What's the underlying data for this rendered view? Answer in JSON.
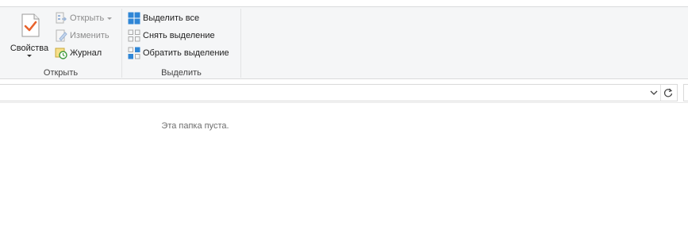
{
  "ribbon": {
    "open_group": {
      "label": "Открыть",
      "properties": {
        "label": "Свойства",
        "icon": "properties-check-icon"
      },
      "open": {
        "label": "Открыть",
        "icon": "open-icon",
        "disabled": true
      },
      "edit": {
        "label": "Изменить",
        "icon": "edit-icon",
        "disabled": true
      },
      "history": {
        "label": "Журнал",
        "icon": "history-icon",
        "disabled": false
      }
    },
    "select_group": {
      "label": "Выделить",
      "select_all": {
        "label": "Выделить все",
        "icon": "select-all-icon"
      },
      "select_none": {
        "label": "Снять выделение",
        "icon": "select-none-icon"
      },
      "invert_selection": {
        "label": "Обратить выделение",
        "icon": "invert-selection-icon"
      }
    }
  },
  "address_bar": {
    "value": "",
    "dropdown_icon": "chevron-down-icon",
    "refresh_icon": "refresh-icon"
  },
  "content": {
    "empty_message": "Эта папка пуста."
  },
  "colors": {
    "ribbon_bg": "#f5f6f7",
    "accent_blue": "#2f86d6",
    "check_orange": "#e8622c"
  }
}
